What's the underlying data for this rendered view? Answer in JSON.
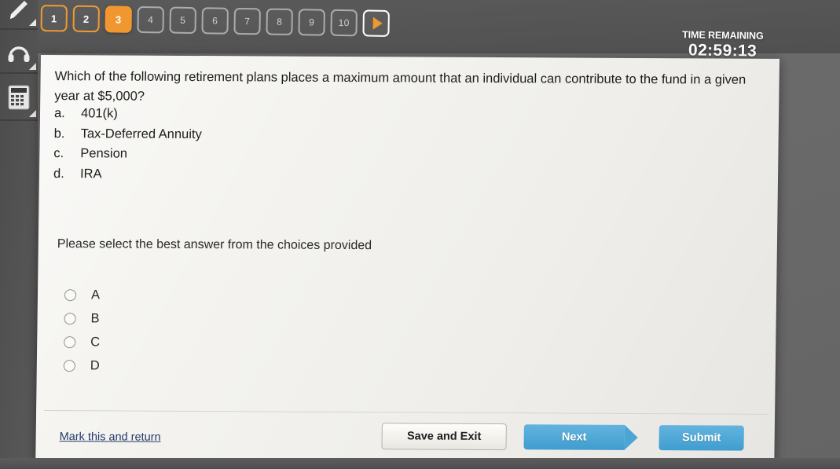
{
  "question_nav": {
    "buttons": [
      {
        "label": "1",
        "state": "done"
      },
      {
        "label": "2",
        "state": "done"
      },
      {
        "label": "3",
        "state": "current"
      },
      {
        "label": "4",
        "state": "upcoming"
      },
      {
        "label": "5",
        "state": "upcoming"
      },
      {
        "label": "6",
        "state": "upcoming"
      },
      {
        "label": "7",
        "state": "upcoming"
      },
      {
        "label": "8",
        "state": "upcoming"
      },
      {
        "label": "9",
        "state": "upcoming"
      },
      {
        "label": "10",
        "state": "upcoming"
      }
    ],
    "next_arrow_icon": "play-arrow-icon"
  },
  "timer": {
    "label": "TIME REMAINING",
    "value": "02:59:13"
  },
  "left_rail": {
    "items": [
      {
        "icon": "pencil-icon"
      },
      {
        "icon": "headphones-icon"
      },
      {
        "icon": "calculator-icon"
      }
    ]
  },
  "question": {
    "text": "Which of the following retirement plans places a maximum amount that an individual can contribute to the fund in a given year at $5,000?",
    "choices": [
      {
        "letter": "a.",
        "text": "401(k)"
      },
      {
        "letter": "b.",
        "text": "Tax-Deferred Annuity"
      },
      {
        "letter": "c.",
        "text": "Pension"
      },
      {
        "letter": "d.",
        "text": "IRA"
      }
    ],
    "instruction": "Please select the best answer from the choices provided",
    "options": [
      {
        "label": "A",
        "selected": false
      },
      {
        "label": "B",
        "selected": false
      },
      {
        "label": "C",
        "selected": false
      },
      {
        "label": "D",
        "selected": false
      }
    ]
  },
  "footer": {
    "mark_link": "Mark this and return",
    "save_and_exit": "Save and Exit",
    "next": "Next",
    "submit": "Submit"
  },
  "colors": {
    "accent_orange": "#f0982f",
    "accent_blue": "#4ba6d6",
    "link_blue": "#233b6c",
    "panel_bg": "#f3f2ee",
    "screen_bg": "#6e6e6e",
    "nav_bg": "#545455"
  }
}
